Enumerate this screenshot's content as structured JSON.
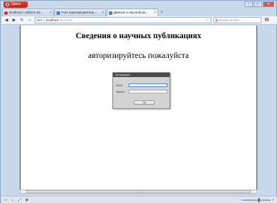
{
  "window": {
    "menu_label": "Opera",
    "controls": {
      "minimize": "–",
      "maximize": "□",
      "close": "✕"
    }
  },
  "tabs": [
    {
      "label": "localhost / Uniform Se...",
      "icon": "opera-icon",
      "active": false
    },
    {
      "label": "Учет научной деятель...",
      "icon": "page-icon",
      "active": false
    },
    {
      "label": "Данные о научной ра...",
      "icon": "page-icon",
      "active": true
    }
  ],
  "toolbar": {
    "security_label": "Веб",
    "host": "localhost",
    "path": "/sur.html",
    "search_placeholder": "Искать в Goo...",
    "search_engine_letter": "g"
  },
  "page": {
    "title": "Сведения о научных публикациях",
    "subtitle": "авторизируйтесь пожалуйста"
  },
  "login": {
    "header": "Авторизация",
    "login_label": "Логин",
    "login_value": "",
    "password_label": "Пароль",
    "password_value": "",
    "submit_label": "Ок"
  }
}
